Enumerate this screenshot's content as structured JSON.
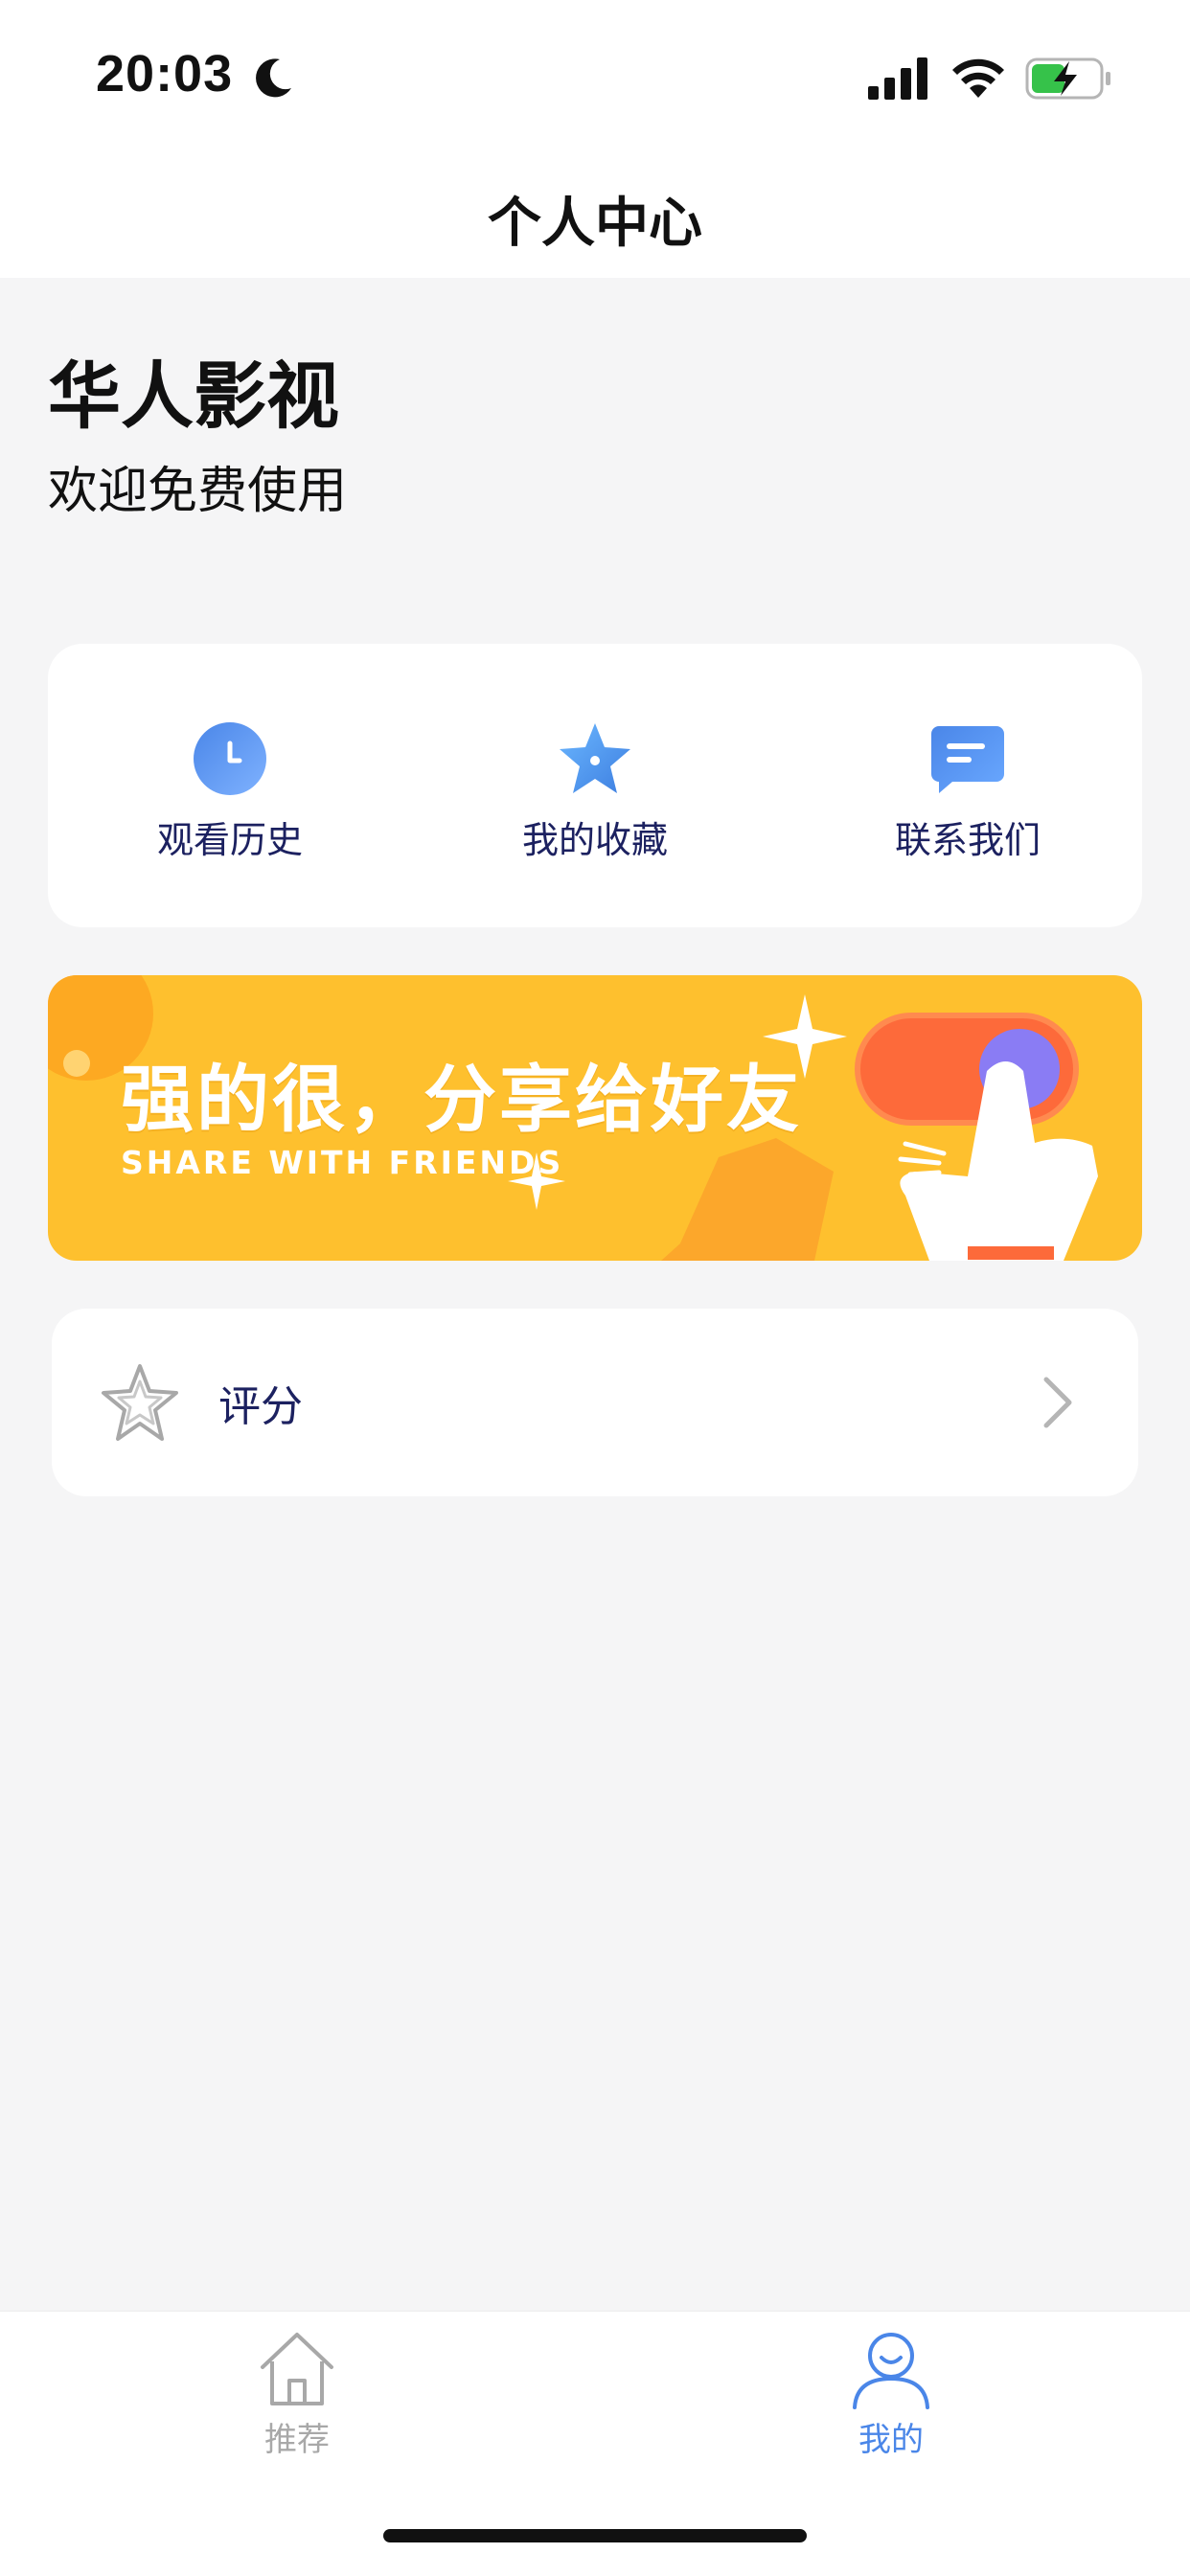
{
  "status_bar": {
    "time": "20:03"
  },
  "nav": {
    "title": "个人中心"
  },
  "profile": {
    "app_name": "华人影视",
    "welcome": "欢迎免费使用"
  },
  "quick_actions": [
    {
      "label": "观看历史",
      "icon": "clock-icon"
    },
    {
      "label": "我的收藏",
      "icon": "star-icon"
    },
    {
      "label": "联系我们",
      "icon": "message-icon"
    }
  ],
  "share_banner": {
    "title": "强的很，分享给好友",
    "subtitle": "SHARE WITH FRIENDS"
  },
  "menu": {
    "rating_label": "评分"
  },
  "tab_bar": {
    "tabs": [
      {
        "label": "推荐",
        "icon": "home-icon",
        "active": false
      },
      {
        "label": "我的",
        "icon": "person-icon",
        "active": true
      }
    ]
  },
  "colors": {
    "accent": "#4a86e8",
    "banner": "#fec02e",
    "inactive": "#a8a8a8",
    "label_dark": "#1c2160"
  }
}
